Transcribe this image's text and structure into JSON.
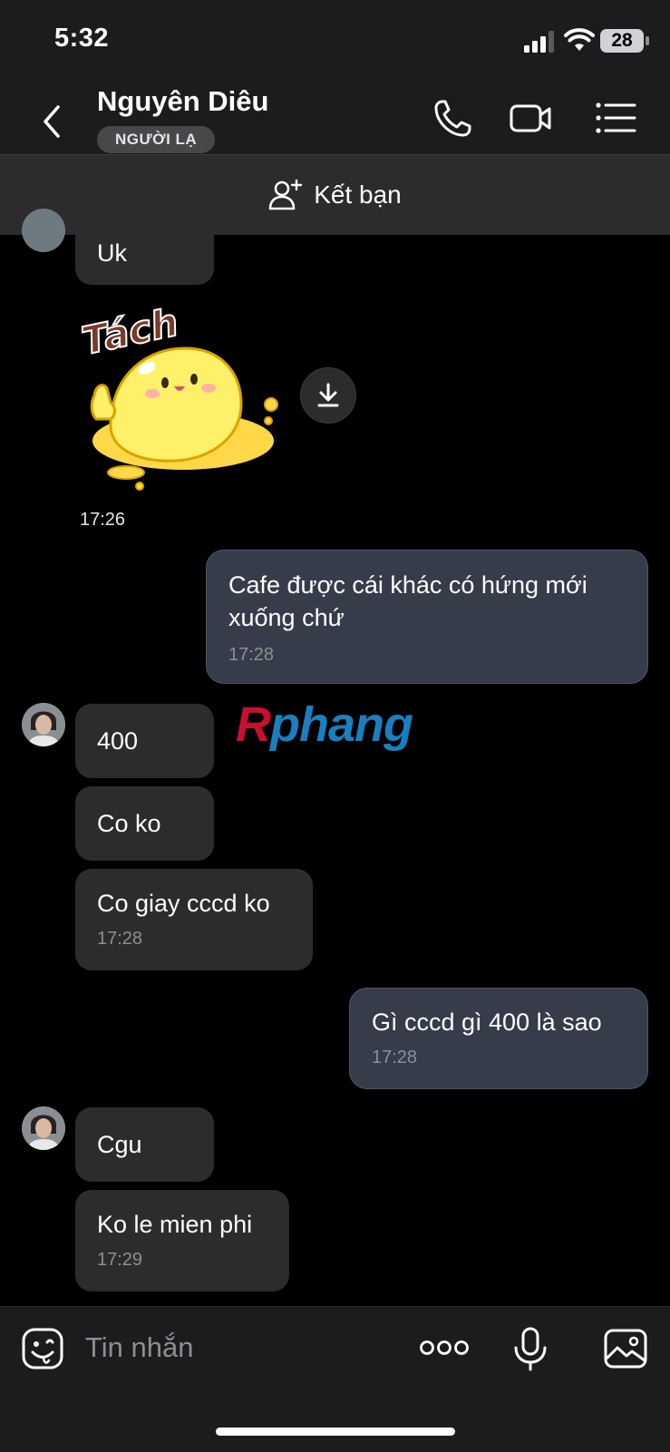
{
  "status": {
    "time": "5:32",
    "battery": "28"
  },
  "header": {
    "name": "Nguyên Diêu",
    "badge": "NGƯỜI LẠ"
  },
  "add_friend": {
    "label": "Kết bạn"
  },
  "messages": [
    {
      "from": "them",
      "text": "Uk"
    },
    {
      "from": "them",
      "sticker_text": "Tách",
      "time": "17:26"
    },
    {
      "from": "me",
      "text_line1": "Cafe được cái khác có hứng mới",
      "text_line2": "xuống chứ",
      "time": "17:28"
    },
    {
      "from": "them",
      "text": "400"
    },
    {
      "from": "them",
      "text": "Co ko"
    },
    {
      "from": "them",
      "text": "Co giay cccd ko",
      "time": "17:28"
    },
    {
      "from": "me",
      "text": "Gì cccd gì 400 là sao",
      "time": "17:28"
    },
    {
      "from": "them",
      "text": "Cgu"
    },
    {
      "from": "them",
      "text": "Ko le mien phi",
      "time": "17:29"
    }
  ],
  "watermark": {
    "part1": "R",
    "part2": "phang"
  },
  "composer": {
    "placeholder": "Tin nhắn"
  },
  "colors": {
    "incoming_bubble": "#2c2c2e",
    "outgoing_bubble": "#363c4a",
    "background": "#000000"
  }
}
